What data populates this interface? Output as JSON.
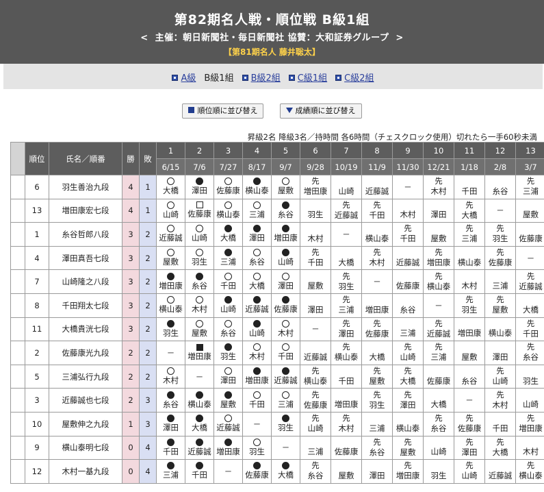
{
  "header": {
    "title": "第82期名人戦・順位戦 B級1組",
    "sponsor_prefix": "<",
    "sponsor": "主催：朝日新聞社・毎日新聞社 協賛：大和証券グループ",
    "sponsor_suffix": ">",
    "holder": "【第81期名人 藤井聡太】"
  },
  "nav": {
    "items": [
      {
        "label": "A級",
        "current": false
      },
      {
        "label": "B級1組",
        "current": true
      },
      {
        "label": "B級2組",
        "current": false
      },
      {
        "label": "C級1組",
        "current": false
      },
      {
        "label": "C級2組",
        "current": false
      }
    ]
  },
  "sort_buttons": {
    "by_rank": "順位順に並び替え",
    "by_record": "成績順に並び替え"
  },
  "rules": "昇級2名 降級3名／持時間 各6時間（チェスクロック使用）切れたら一手60秒未満",
  "table": {
    "headers": {
      "rank": "順位",
      "name": "氏名／順番",
      "wins": "勝",
      "losses": "敗"
    },
    "rounds": [
      "1",
      "2",
      "3",
      "4",
      "5",
      "6",
      "7",
      "8",
      "9",
      "10",
      "11",
      "12",
      "13"
    ],
    "dates": [
      "6/15",
      "7/6",
      "7/27",
      "8/17",
      "9/7",
      "9/28",
      "10/19",
      "11/9",
      "11/30",
      "12/21",
      "1/18",
      "2/8",
      "3/7"
    ],
    "sente_mark": "先",
    "dash": "－",
    "rows": [
      {
        "rank": "6",
        "name": "羽生善治九段",
        "wins": "4",
        "losses": "1",
        "games": [
          [
            "W",
            "",
            "大橋"
          ],
          [
            "L",
            "",
            "澤田"
          ],
          [
            "W",
            "",
            "佐藤康"
          ],
          [
            "L",
            "",
            "横山泰"
          ],
          [
            "W",
            "",
            "屋敷"
          ],
          [
            "",
            "先",
            "増田康"
          ],
          [
            "",
            "",
            "山崎"
          ],
          [
            "",
            "",
            "近藤誠"
          ],
          [
            "-",
            "",
            ""
          ],
          [
            "",
            "先",
            "木村"
          ],
          [
            "",
            "",
            "千田"
          ],
          [
            "",
            "",
            "糸谷"
          ],
          [
            "",
            "先",
            "三浦"
          ]
        ]
      },
      {
        "rank": "13",
        "name": "増田康宏七段",
        "wins": "4",
        "losses": "1",
        "games": [
          [
            "W",
            "",
            "山崎"
          ],
          [
            "WD",
            "",
            "佐藤康"
          ],
          [
            "W",
            "",
            "横山泰"
          ],
          [
            "W",
            "",
            "三浦"
          ],
          [
            "L",
            "",
            "糸谷"
          ],
          [
            "",
            "",
            "羽生"
          ],
          [
            "",
            "先",
            "近藤誠"
          ],
          [
            "",
            "先",
            "千田"
          ],
          [
            "",
            "",
            "木村"
          ],
          [
            "",
            "",
            "澤田"
          ],
          [
            "",
            "先",
            "大橋"
          ],
          [
            "-",
            "",
            ""
          ],
          [
            "",
            "",
            "屋敷"
          ]
        ]
      },
      {
        "rank": "1",
        "name": "糸谷哲郎八段",
        "wins": "3",
        "losses": "2",
        "games": [
          [
            "W",
            "",
            "近藤誠"
          ],
          [
            "W",
            "",
            "山崎"
          ],
          [
            "L",
            "",
            "大橋"
          ],
          [
            "L",
            "",
            "澤田"
          ],
          [
            "L",
            "",
            "増田康"
          ],
          [
            "",
            "",
            "木村"
          ],
          [
            "-",
            "",
            ""
          ],
          [
            "",
            "",
            "横山泰"
          ],
          [
            "",
            "先",
            "千田"
          ],
          [
            "",
            "",
            "屋敷"
          ],
          [
            "",
            "先",
            "三浦"
          ],
          [
            "",
            "先",
            "羽生"
          ],
          [
            "",
            "",
            "佐藤康"
          ]
        ]
      },
      {
        "rank": "4",
        "name": "澤田真吾七段",
        "wins": "3",
        "losses": "2",
        "games": [
          [
            "W",
            "",
            "屋敷"
          ],
          [
            "W",
            "",
            "羽生"
          ],
          [
            "L",
            "",
            "三浦"
          ],
          [
            "W",
            "",
            "糸谷"
          ],
          [
            "L",
            "",
            "山崎"
          ],
          [
            "",
            "先",
            "千田"
          ],
          [
            "",
            "",
            "大橋"
          ],
          [
            "",
            "先",
            "木村"
          ],
          [
            "",
            "",
            "近藤誠"
          ],
          [
            "",
            "先",
            "増田康"
          ],
          [
            "",
            "",
            "横山泰"
          ],
          [
            "",
            "先",
            "佐藤康"
          ],
          [
            "-",
            "",
            ""
          ]
        ]
      },
      {
        "rank": "7",
        "name": "山崎隆之八段",
        "wins": "3",
        "losses": "2",
        "games": [
          [
            "L",
            "",
            "増田康"
          ],
          [
            "L",
            "",
            "糸谷"
          ],
          [
            "W",
            "",
            "千田"
          ],
          [
            "W",
            "",
            "大橋"
          ],
          [
            "W",
            "",
            "澤田"
          ],
          [
            "",
            "",
            "屋敷"
          ],
          [
            "",
            "先",
            "羽生"
          ],
          [
            "-",
            "",
            ""
          ],
          [
            "",
            "",
            "佐藤康"
          ],
          [
            "",
            "先",
            "横山泰"
          ],
          [
            "",
            "",
            "木村"
          ],
          [
            "",
            "",
            "三浦"
          ],
          [
            "",
            "先",
            "近藤誠"
          ]
        ]
      },
      {
        "rank": "8",
        "name": "千田翔太七段",
        "wins": "3",
        "losses": "2",
        "games": [
          [
            "W",
            "",
            "横山泰"
          ],
          [
            "W",
            "",
            "木村"
          ],
          [
            "L",
            "",
            "山崎"
          ],
          [
            "L",
            "",
            "近藤誠"
          ],
          [
            "L",
            "",
            "佐藤康"
          ],
          [
            "",
            "",
            "澤田"
          ],
          [
            "",
            "先",
            "三浦"
          ],
          [
            "",
            "",
            "増田康"
          ],
          [
            "",
            "",
            "糸谷"
          ],
          [
            "-",
            "",
            ""
          ],
          [
            "",
            "先",
            "羽生"
          ],
          [
            "",
            "先",
            "屋敷"
          ],
          [
            "",
            "",
            "大橋"
          ]
        ]
      },
      {
        "rank": "11",
        "name": "大橋貴洸七段",
        "wins": "3",
        "losses": "2",
        "games": [
          [
            "L",
            "",
            "羽生"
          ],
          [
            "W",
            "",
            "屋敷"
          ],
          [
            "W",
            "",
            "糸谷"
          ],
          [
            "L",
            "",
            "山崎"
          ],
          [
            "W",
            "",
            "木村"
          ],
          [
            "-",
            "",
            ""
          ],
          [
            "",
            "先",
            "澤田"
          ],
          [
            "",
            "先",
            "佐藤康"
          ],
          [
            "",
            "",
            "三浦"
          ],
          [
            "",
            "先",
            "近藤誠"
          ],
          [
            "",
            "",
            "増田康"
          ],
          [
            "",
            "",
            "横山泰"
          ],
          [
            "",
            "先",
            "千田"
          ]
        ]
      },
      {
        "rank": "2",
        "name": "佐藤康光九段",
        "wins": "2",
        "losses": "2",
        "games": [
          [
            "-",
            "",
            ""
          ],
          [
            "LD",
            "",
            "増田康"
          ],
          [
            "L",
            "",
            "羽生"
          ],
          [
            "W",
            "",
            "木村"
          ],
          [
            "W",
            "",
            "千田"
          ],
          [
            "",
            "",
            "近藤誠"
          ],
          [
            "",
            "先",
            "横山泰"
          ],
          [
            "",
            "",
            "大橋"
          ],
          [
            "",
            "先",
            "山崎"
          ],
          [
            "",
            "先",
            "三浦"
          ],
          [
            "",
            "",
            "屋敷"
          ],
          [
            "",
            "",
            "澤田"
          ],
          [
            "",
            "先",
            "糸谷"
          ]
        ]
      },
      {
        "rank": "5",
        "name": "三浦弘行九段",
        "wins": "2",
        "losses": "2",
        "games": [
          [
            "W",
            "",
            "木村"
          ],
          [
            "-",
            "",
            ""
          ],
          [
            "W",
            "",
            "澤田"
          ],
          [
            "L",
            "",
            "増田康"
          ],
          [
            "L",
            "",
            "近藤誠"
          ],
          [
            "",
            "先",
            "横山泰"
          ],
          [
            "",
            "",
            "千田"
          ],
          [
            "",
            "先",
            "屋敷"
          ],
          [
            "",
            "先",
            "大橋"
          ],
          [
            "",
            "",
            "佐藤康"
          ],
          [
            "",
            "",
            "糸谷"
          ],
          [
            "",
            "先",
            "山崎"
          ],
          [
            "",
            "",
            "羽生"
          ]
        ]
      },
      {
        "rank": "3",
        "name": "近藤誠也七段",
        "wins": "2",
        "losses": "3",
        "games": [
          [
            "L",
            "",
            "糸谷"
          ],
          [
            "L",
            "",
            "横山泰"
          ],
          [
            "L",
            "",
            "屋敷"
          ],
          [
            "W",
            "",
            "千田"
          ],
          [
            "W",
            "",
            "三浦"
          ],
          [
            "",
            "先",
            "佐藤康"
          ],
          [
            "",
            "",
            "増田康"
          ],
          [
            "",
            "先",
            "羽生"
          ],
          [
            "",
            "先",
            "澤田"
          ],
          [
            "",
            "",
            "大橋"
          ],
          [
            "-",
            "",
            ""
          ],
          [
            "",
            "先",
            "木村"
          ],
          [
            "",
            "",
            "山崎"
          ]
        ]
      },
      {
        "rank": "10",
        "name": "屋敷伸之九段",
        "wins": "1",
        "losses": "3",
        "games": [
          [
            "L",
            "",
            "澤田"
          ],
          [
            "L",
            "",
            "大橋"
          ],
          [
            "W",
            "",
            "近藤誠"
          ],
          [
            "-",
            "",
            ""
          ],
          [
            "L",
            "",
            "羽生"
          ],
          [
            "",
            "先",
            "山崎"
          ],
          [
            "",
            "先",
            "木村"
          ],
          [
            "",
            "",
            "三浦"
          ],
          [
            "",
            "",
            "横山泰"
          ],
          [
            "",
            "先",
            "糸谷"
          ],
          [
            "",
            "先",
            "佐藤康"
          ],
          [
            "",
            "",
            "千田"
          ],
          [
            "",
            "先",
            "増田康"
          ]
        ]
      },
      {
        "rank": "9",
        "name": "横山泰明七段",
        "wins": "0",
        "losses": "4",
        "games": [
          [
            "L",
            "",
            "千田"
          ],
          [
            "L",
            "",
            "近藤誠"
          ],
          [
            "L",
            "",
            "増田康"
          ],
          [
            "W",
            "",
            "羽生"
          ],
          [
            "-",
            "",
            ""
          ],
          [
            "",
            "",
            "三浦"
          ],
          [
            "",
            "",
            "佐藤康"
          ],
          [
            "",
            "先",
            "糸谷"
          ],
          [
            "",
            "先",
            "屋敷"
          ],
          [
            "",
            "",
            "山崎"
          ],
          [
            "",
            "先",
            "澤田"
          ],
          [
            "",
            "先",
            "大橋"
          ],
          [
            "",
            "",
            "木村"
          ]
        ]
      },
      {
        "rank": "12",
        "name": "木村一基九段",
        "wins": "0",
        "losses": "4",
        "games": [
          [
            "L",
            "",
            "三浦"
          ],
          [
            "L",
            "",
            "千田"
          ],
          [
            "-",
            "",
            ""
          ],
          [
            "L",
            "",
            "佐藤康"
          ],
          [
            "L",
            "",
            "大橋"
          ],
          [
            "",
            "先",
            "糸谷"
          ],
          [
            "",
            "",
            "屋敷"
          ],
          [
            "",
            "",
            "澤田"
          ],
          [
            "",
            "先",
            "増田康"
          ],
          [
            "",
            "",
            "羽生"
          ],
          [
            "",
            "先",
            "山崎"
          ],
          [
            "",
            "",
            "近藤誠"
          ],
          [
            "",
            "先",
            "横山泰"
          ]
        ]
      }
    ]
  }
}
